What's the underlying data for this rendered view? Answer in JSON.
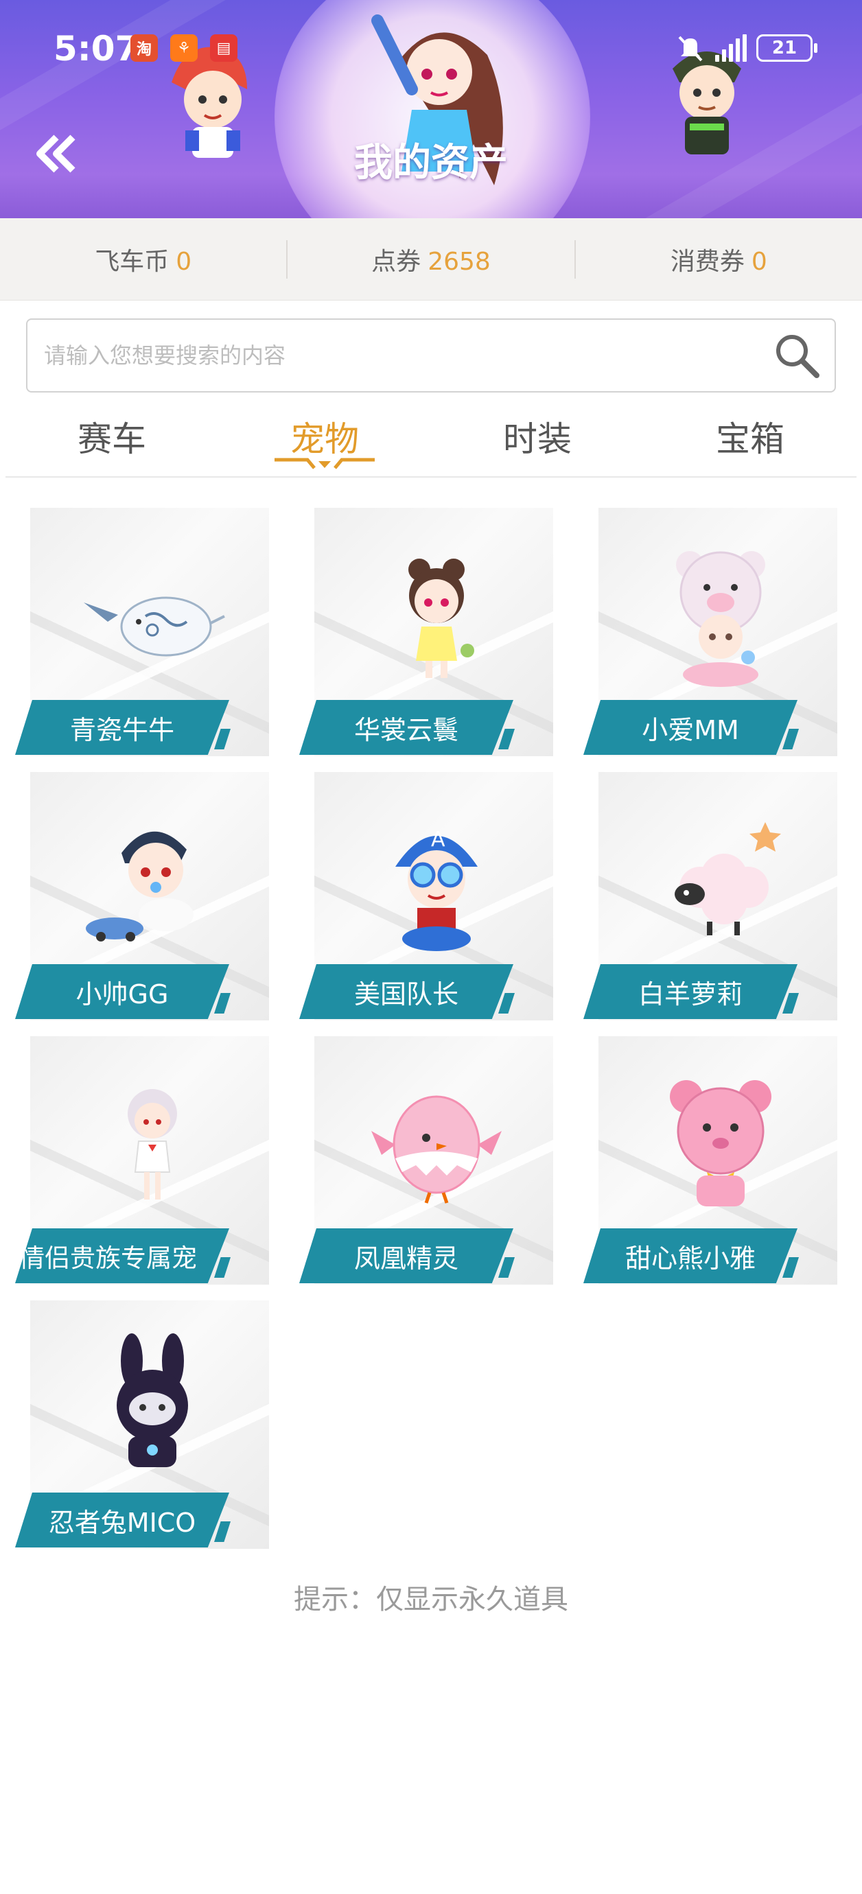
{
  "status_bar": {
    "time": "5:07",
    "battery": "21",
    "apps": [
      "taobao",
      "figure",
      "book"
    ]
  },
  "header": {
    "title": "我的资产"
  },
  "currencies": [
    {
      "label": "飞车币",
      "value": "0"
    },
    {
      "label": "点券",
      "value": "2658"
    },
    {
      "label": "消费券",
      "value": "0"
    }
  ],
  "search": {
    "placeholder": "请输入您想要搜索的内容"
  },
  "tabs": [
    {
      "label": "赛车",
      "active": false
    },
    {
      "label": "宠物",
      "active": true
    },
    {
      "label": "时装",
      "active": false
    },
    {
      "label": "宝箱",
      "active": false
    }
  ],
  "pets": [
    {
      "name": "青瓷牛牛",
      "icon": "porcelain-cow-icon"
    },
    {
      "name": "华裳云鬟",
      "icon": "chinese-girl-icon"
    },
    {
      "name": "小爱MM",
      "icon": "bear-hat-baby-icon"
    },
    {
      "name": "小帅GG",
      "icon": "baby-boy-icon"
    },
    {
      "name": "美国队长",
      "icon": "captain-america-icon"
    },
    {
      "name": "白羊萝莉",
      "icon": "sheep-icon"
    },
    {
      "name": "情侣贵族专属宠",
      "icon": "white-hair-girl-icon"
    },
    {
      "name": "凤凰精灵",
      "icon": "phoenix-chick-icon"
    },
    {
      "name": "甜心熊小雅",
      "icon": "pink-bear-icon"
    },
    {
      "name": "忍者兔MICO",
      "icon": "ninja-rabbit-icon"
    }
  ],
  "hint": "提示：仅显示永久道具",
  "colors": {
    "accent": "#e29b2a",
    "label_teal": "#1f8ea3",
    "header_purple": "#8a63e6"
  }
}
